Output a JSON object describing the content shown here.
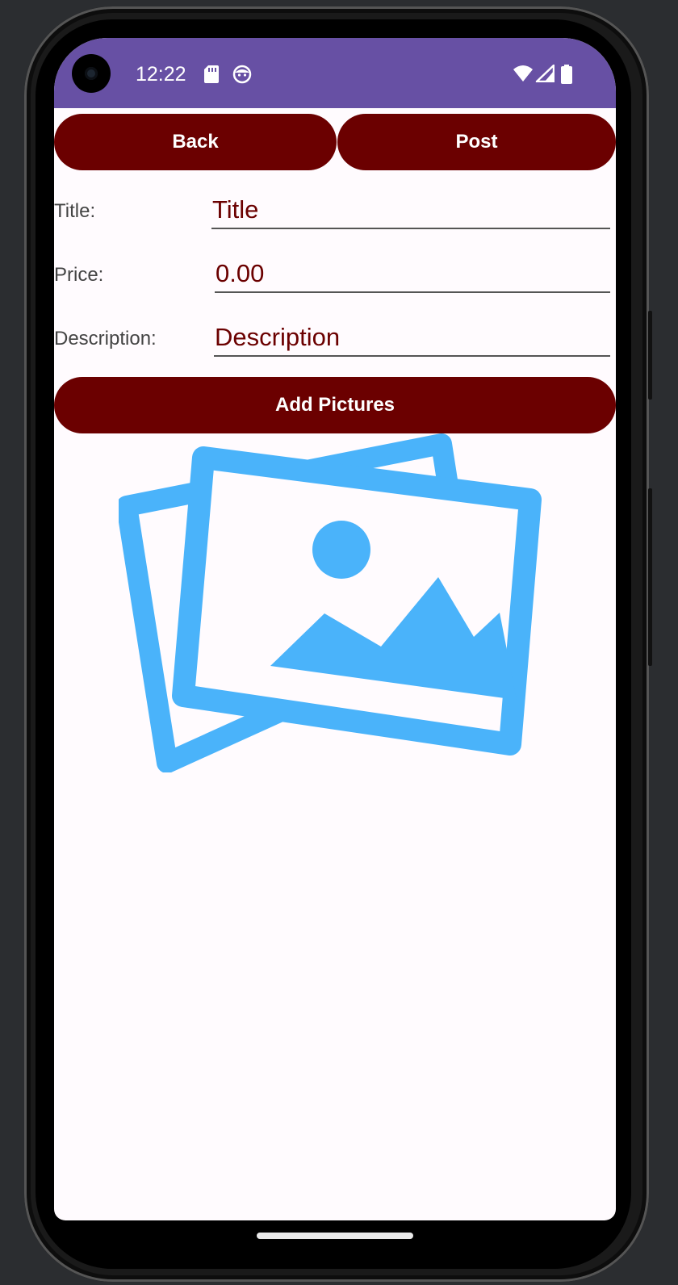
{
  "status_bar": {
    "time": "12:22",
    "icons": [
      "sd-card-icon",
      "face-icon",
      "wifi-icon",
      "signal-icon",
      "battery-icon"
    ],
    "color": "#6750a4"
  },
  "toolbar": {
    "back_label": "Back",
    "post_label": "Post"
  },
  "form": {
    "title_label": "Title:",
    "title_value": "Title",
    "price_label": "Price:",
    "price_value": "0.00",
    "description_label": "Description:",
    "description_value": "Description"
  },
  "add_pictures_label": "Add Pictures",
  "image_placeholder": {
    "icon": "image-gallery-icon",
    "color": "#4ab3fa"
  },
  "colors": {
    "button": "#6b0000",
    "field_text": "#6b0000",
    "background": "#fffbfe"
  }
}
